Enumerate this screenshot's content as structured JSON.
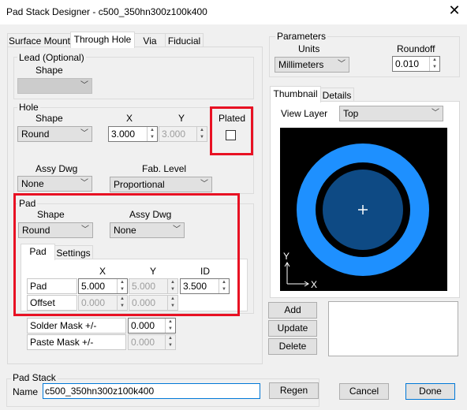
{
  "window": {
    "title": "Pad Stack Designer - c500_350hn300z100k400",
    "close_icon": "close-icon"
  },
  "tabs": [
    "Surface Mount",
    "Through Hole",
    "Via",
    "Fiducial"
  ],
  "lead": {
    "group": "Lead (Optional)",
    "shape_label": "Shape",
    "shape_value": ""
  },
  "hole": {
    "group": "Hole",
    "shape_label": "Shape",
    "shape_value": "Round",
    "x_label": "X",
    "y_label": "Y",
    "x_value": "3.000",
    "y_value": "3.000",
    "plated_label": "Plated",
    "plated": false,
    "assy_label": "Assy Dwg",
    "assy_value": "None",
    "fab_label": "Fab. Level",
    "fab_value": "Proportional"
  },
  "pad": {
    "group": "Pad",
    "shape_label": "Shape",
    "shape_value": "Round",
    "assy_label": "Assy Dwg",
    "assy_value": "None",
    "tabs": [
      "Pad",
      "Settings"
    ],
    "col_x": "X",
    "col_y": "Y",
    "col_id": "ID",
    "row_pad": "Pad",
    "pad_x": "5.000",
    "pad_y": "5.000",
    "pad_id": "3.500",
    "row_offset": "Offset",
    "offset_x": "0.000",
    "offset_y": "0.000"
  },
  "mask": {
    "solder_label": "Solder Mask +/-",
    "solder_value": "0.000",
    "paste_label": "Paste Mask +/-",
    "paste_value": "0.000"
  },
  "parameters": {
    "group": "Parameters",
    "units_label": "Units",
    "units_value": "Millimeters",
    "roundoff_label": "Roundoff",
    "roundoff_value": "0.010"
  },
  "preview": {
    "tabs": [
      "Thumbnail",
      "Details"
    ],
    "view_layer_label": "View Layer",
    "view_layer_value": "Top",
    "axis_y": "Y",
    "axis_x": "X",
    "colors": {
      "ring": "#1e90ff",
      "pad": "#0e4a84",
      "bg": "#000000"
    }
  },
  "actions": {
    "add": "Add",
    "update": "Update",
    "delete": "Delete"
  },
  "padstack": {
    "group": "Pad Stack",
    "name_label": "Name",
    "name_value": "c500_350hn300z100k400",
    "regen": "Regen"
  },
  "footer": {
    "cancel": "Cancel",
    "done": "Done"
  }
}
